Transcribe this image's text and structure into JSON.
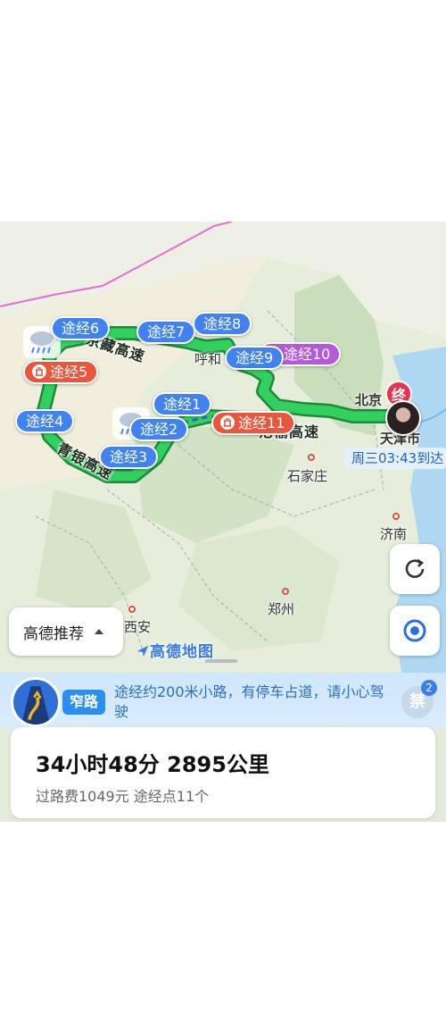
{
  "map": {
    "road_labels": [
      "京藏高速",
      "青银高速",
      "沧榆高速"
    ],
    "cities": [
      "呼和",
      "北京",
      "天津市",
      "石家庄",
      "济南",
      "郑州",
      "西安"
    ],
    "waypoints": {
      "wp1": "途经1",
      "wp2": "途经2",
      "wp3": "途经3",
      "wp4": "途经4",
      "wp5": "途经5",
      "wp6": "途经6",
      "wp7": "途经7",
      "wp8": "途经8",
      "wp9": "途经9",
      "wp10": "途经10",
      "wp11": "途经11"
    },
    "destination_marker": "终",
    "eta": "周三03:43到达",
    "route_color": "#2fc95a",
    "logo": "高德地图"
  },
  "controls": {
    "preference_label": "高德推荐",
    "refresh_icon": "refresh-icon",
    "locate_icon": "locate-icon"
  },
  "warning": {
    "badge": "窄路",
    "message": "途经约200米小路，有停车占道，请小心驾驶",
    "no_entry_label": "禁",
    "count": "2"
  },
  "summary": {
    "duration_distance": "34小时48分  2895公里",
    "details": "过路费1049元  途经点11个"
  }
}
